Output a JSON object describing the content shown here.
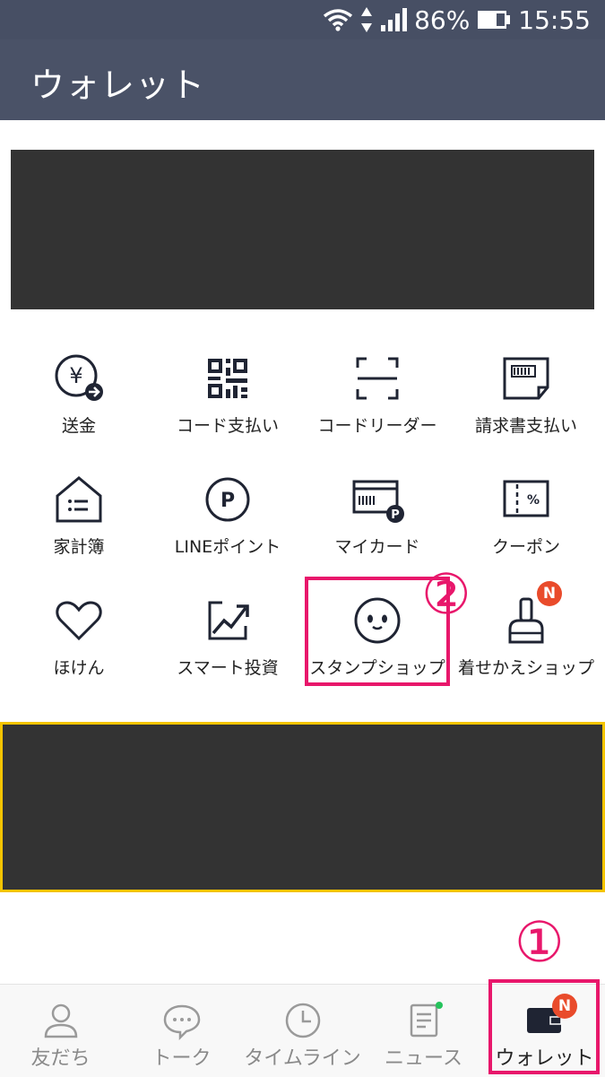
{
  "status": {
    "battery": "86%",
    "time": "15:55"
  },
  "header": {
    "title": "ウォレット"
  },
  "menu": {
    "row1": [
      "送金",
      "コード支払い",
      "コードリーダー",
      "請求書支払い"
    ],
    "row2": [
      "家計簿",
      "LINEポイント",
      "マイカード",
      "クーポン"
    ],
    "row3": [
      "ほけん",
      "スマート投資",
      "スタンプショップ",
      "着せかえショップ"
    ]
  },
  "badges": {
    "new": "N"
  },
  "annotations": {
    "one": "①",
    "two": "②"
  },
  "tabs": [
    "友だち",
    "トーク",
    "タイムライン",
    "ニュース",
    "ウォレット"
  ],
  "colors": {
    "header_bg": "#4a5267",
    "highlight": "#e8176b",
    "badge": "#e94b2b",
    "banner_border": "#f5c400"
  }
}
